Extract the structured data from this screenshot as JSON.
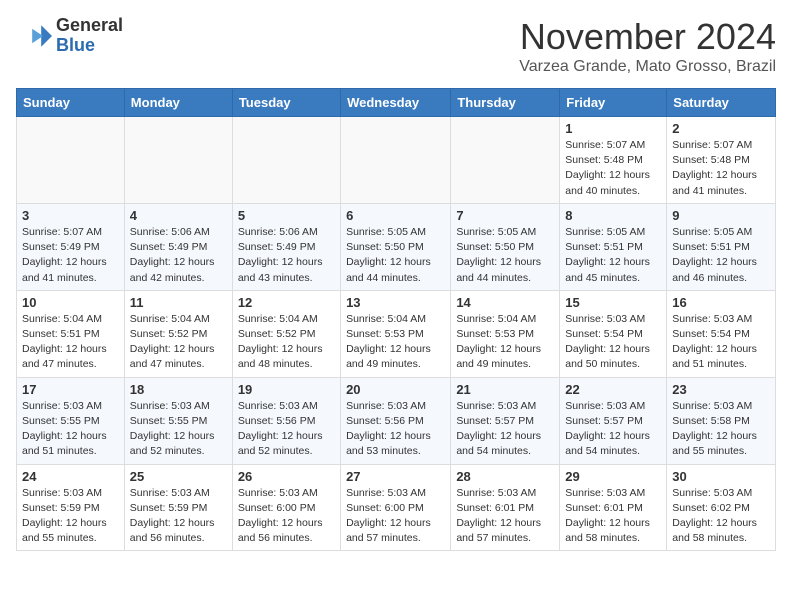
{
  "header": {
    "logo_line1": "General",
    "logo_line2": "Blue",
    "month": "November 2024",
    "location": "Varzea Grande, Mato Grosso, Brazil"
  },
  "weekdays": [
    "Sunday",
    "Monday",
    "Tuesday",
    "Wednesday",
    "Thursday",
    "Friday",
    "Saturday"
  ],
  "weeks": [
    [
      {
        "day": "",
        "info": ""
      },
      {
        "day": "",
        "info": ""
      },
      {
        "day": "",
        "info": ""
      },
      {
        "day": "",
        "info": ""
      },
      {
        "day": "",
        "info": ""
      },
      {
        "day": "1",
        "info": "Sunrise: 5:07 AM\nSunset: 5:48 PM\nDaylight: 12 hours\nand 40 minutes."
      },
      {
        "day": "2",
        "info": "Sunrise: 5:07 AM\nSunset: 5:48 PM\nDaylight: 12 hours\nand 41 minutes."
      }
    ],
    [
      {
        "day": "3",
        "info": "Sunrise: 5:07 AM\nSunset: 5:49 PM\nDaylight: 12 hours\nand 41 minutes."
      },
      {
        "day": "4",
        "info": "Sunrise: 5:06 AM\nSunset: 5:49 PM\nDaylight: 12 hours\nand 42 minutes."
      },
      {
        "day": "5",
        "info": "Sunrise: 5:06 AM\nSunset: 5:49 PM\nDaylight: 12 hours\nand 43 minutes."
      },
      {
        "day": "6",
        "info": "Sunrise: 5:05 AM\nSunset: 5:50 PM\nDaylight: 12 hours\nand 44 minutes."
      },
      {
        "day": "7",
        "info": "Sunrise: 5:05 AM\nSunset: 5:50 PM\nDaylight: 12 hours\nand 44 minutes."
      },
      {
        "day": "8",
        "info": "Sunrise: 5:05 AM\nSunset: 5:51 PM\nDaylight: 12 hours\nand 45 minutes."
      },
      {
        "day": "9",
        "info": "Sunrise: 5:05 AM\nSunset: 5:51 PM\nDaylight: 12 hours\nand 46 minutes."
      }
    ],
    [
      {
        "day": "10",
        "info": "Sunrise: 5:04 AM\nSunset: 5:51 PM\nDaylight: 12 hours\nand 47 minutes."
      },
      {
        "day": "11",
        "info": "Sunrise: 5:04 AM\nSunset: 5:52 PM\nDaylight: 12 hours\nand 47 minutes."
      },
      {
        "day": "12",
        "info": "Sunrise: 5:04 AM\nSunset: 5:52 PM\nDaylight: 12 hours\nand 48 minutes."
      },
      {
        "day": "13",
        "info": "Sunrise: 5:04 AM\nSunset: 5:53 PM\nDaylight: 12 hours\nand 49 minutes."
      },
      {
        "day": "14",
        "info": "Sunrise: 5:04 AM\nSunset: 5:53 PM\nDaylight: 12 hours\nand 49 minutes."
      },
      {
        "day": "15",
        "info": "Sunrise: 5:03 AM\nSunset: 5:54 PM\nDaylight: 12 hours\nand 50 minutes."
      },
      {
        "day": "16",
        "info": "Sunrise: 5:03 AM\nSunset: 5:54 PM\nDaylight: 12 hours\nand 51 minutes."
      }
    ],
    [
      {
        "day": "17",
        "info": "Sunrise: 5:03 AM\nSunset: 5:55 PM\nDaylight: 12 hours\nand 51 minutes."
      },
      {
        "day": "18",
        "info": "Sunrise: 5:03 AM\nSunset: 5:55 PM\nDaylight: 12 hours\nand 52 minutes."
      },
      {
        "day": "19",
        "info": "Sunrise: 5:03 AM\nSunset: 5:56 PM\nDaylight: 12 hours\nand 52 minutes."
      },
      {
        "day": "20",
        "info": "Sunrise: 5:03 AM\nSunset: 5:56 PM\nDaylight: 12 hours\nand 53 minutes."
      },
      {
        "day": "21",
        "info": "Sunrise: 5:03 AM\nSunset: 5:57 PM\nDaylight: 12 hours\nand 54 minutes."
      },
      {
        "day": "22",
        "info": "Sunrise: 5:03 AM\nSunset: 5:57 PM\nDaylight: 12 hours\nand 54 minutes."
      },
      {
        "day": "23",
        "info": "Sunrise: 5:03 AM\nSunset: 5:58 PM\nDaylight: 12 hours\nand 55 minutes."
      }
    ],
    [
      {
        "day": "24",
        "info": "Sunrise: 5:03 AM\nSunset: 5:59 PM\nDaylight: 12 hours\nand 55 minutes."
      },
      {
        "day": "25",
        "info": "Sunrise: 5:03 AM\nSunset: 5:59 PM\nDaylight: 12 hours\nand 56 minutes."
      },
      {
        "day": "26",
        "info": "Sunrise: 5:03 AM\nSunset: 6:00 PM\nDaylight: 12 hours\nand 56 minutes."
      },
      {
        "day": "27",
        "info": "Sunrise: 5:03 AM\nSunset: 6:00 PM\nDaylight: 12 hours\nand 57 minutes."
      },
      {
        "day": "28",
        "info": "Sunrise: 5:03 AM\nSunset: 6:01 PM\nDaylight: 12 hours\nand 57 minutes."
      },
      {
        "day": "29",
        "info": "Sunrise: 5:03 AM\nSunset: 6:01 PM\nDaylight: 12 hours\nand 58 minutes."
      },
      {
        "day": "30",
        "info": "Sunrise: 5:03 AM\nSunset: 6:02 PM\nDaylight: 12 hours\nand 58 minutes."
      }
    ]
  ]
}
